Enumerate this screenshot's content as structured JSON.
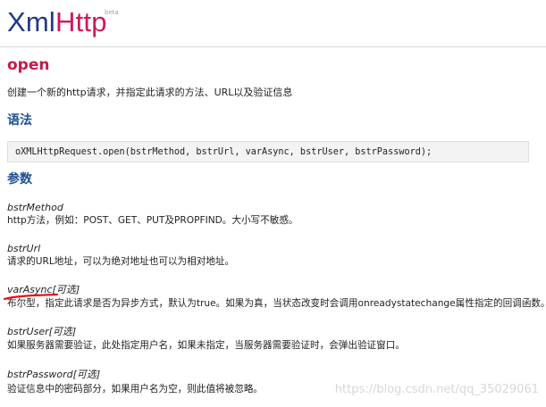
{
  "header": {
    "logo_part1": "Xml",
    "logo_part2": "Http",
    "badge": "beta"
  },
  "page": {
    "title": "open",
    "description": "创建一个新的http请求，并指定此请求的方法、URL以及验证信息",
    "syntax_heading": "语法",
    "syntax_code": "oXMLHttpRequest.open(bstrMethod, bstrUrl, varAsync, bstrUser, bstrPassword);",
    "params_heading": "参数"
  },
  "params": [
    {
      "name": "bstrMethod",
      "description": "http方法，例如：POST、GET、PUT及PROPFIND。大小写不敏感。"
    },
    {
      "name": "bstrUrl",
      "description": "请求的URL地址，可以为绝对地址也可以为相对地址。"
    },
    {
      "name": "varAsync[可选]",
      "description": "布尔型，指定此请求是否为异步方式，默认为true。如果为真，当状态改变时会调用onreadystatechange属性指定的回调函数。"
    },
    {
      "name": "bstrUser[可选]",
      "description": "如果服务器需要验证，此处指定用户名，如果未指定，当服务器需要验证时，会弹出验证窗口。"
    },
    {
      "name": "bstrPassword[可选]",
      "description": "验证信息中的密码部分，如果用户名为空，则此值将被忽略。"
    }
  ],
  "watermark": "https://blog.csdn.net/qq_35029061",
  "colors": {
    "logo_xml": "#203a86",
    "logo_http": "#d3155e",
    "title": "#cc1745",
    "section": "#1d4f95",
    "annotation": "#e0131b"
  }
}
